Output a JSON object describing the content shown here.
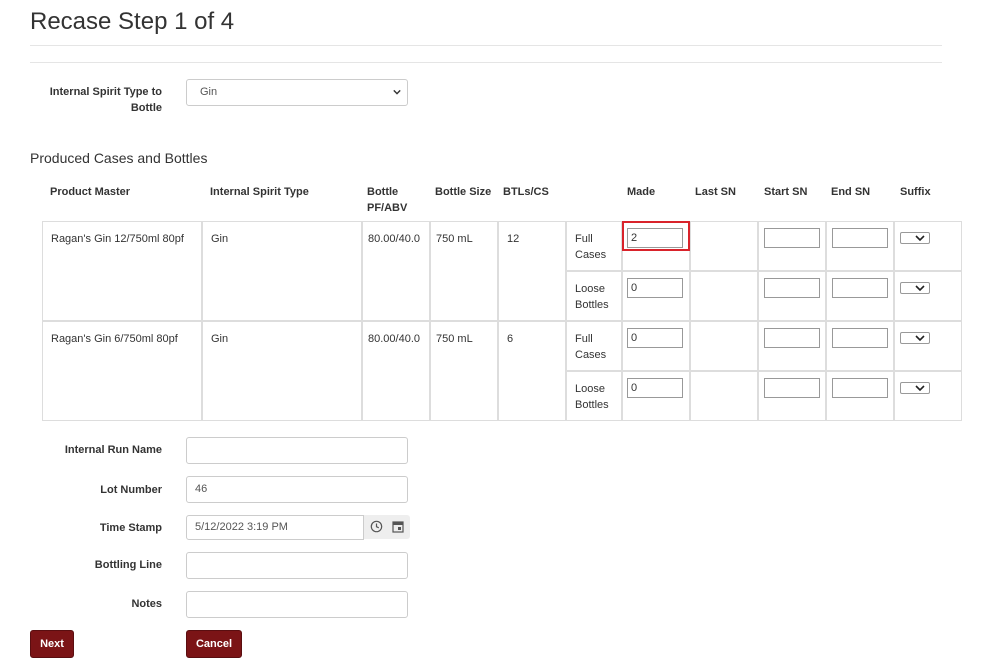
{
  "page": {
    "title": "Recase Step 1 of 4"
  },
  "spirit_type": {
    "label": "Internal Spirit Type to Bottle",
    "label_line1": "Internal Spirit Type to",
    "label_line2": "Bottle",
    "value": "Gin"
  },
  "section_title": "Produced Cases and Bottles",
  "table": {
    "headers": {
      "product_master": "Product Master",
      "internal_spirit_type": "Internal Spirit Type",
      "bottle_pf_line1": "Bottle",
      "bottle_pf_line2": "PF/ABV",
      "bottle_size": "Bottle Size",
      "btls_cs": "BTLs/CS",
      "made": "Made",
      "last_sn": "Last SN",
      "start_sn": "Start SN",
      "end_sn": "End SN",
      "suffix": "Suffix"
    },
    "rows": [
      {
        "product_master": "Ragan's Gin 12/750ml 80pf",
        "spirit_type": "Gin",
        "pf_abv": "80.00/40.0",
        "bottle_size": "750 mL",
        "btls_cs": "12",
        "full_line1": "Full",
        "full_line2": "Cases",
        "full_made": "2",
        "loose_line1": "Loose",
        "loose_line2": "Bottles",
        "loose_made": "0"
      },
      {
        "product_master": "Ragan's Gin 6/750ml 80pf",
        "spirit_type": "Gin",
        "pf_abv": "80.00/40.0",
        "bottle_size": "750 mL",
        "btls_cs": "6",
        "full_line1": "Full",
        "full_line2": "Cases",
        "full_made": "0",
        "loose_line1": "Loose",
        "loose_line2": "Bottles",
        "loose_made": "0"
      }
    ]
  },
  "form": {
    "run_name_label": "Internal Run Name",
    "run_name_value": "",
    "lot_label": "Lot Number",
    "lot_value": "46",
    "timestamp_label": "Time Stamp",
    "timestamp_value": "5/12/2022 3:19 PM",
    "line_label": "Bottling Line",
    "line_value": "",
    "notes_label": "Notes",
    "notes_value": ""
  },
  "buttons": {
    "next": "Next",
    "cancel": "Cancel"
  },
  "colors": {
    "button": "#7b1416",
    "highlight": "#d9232b"
  }
}
